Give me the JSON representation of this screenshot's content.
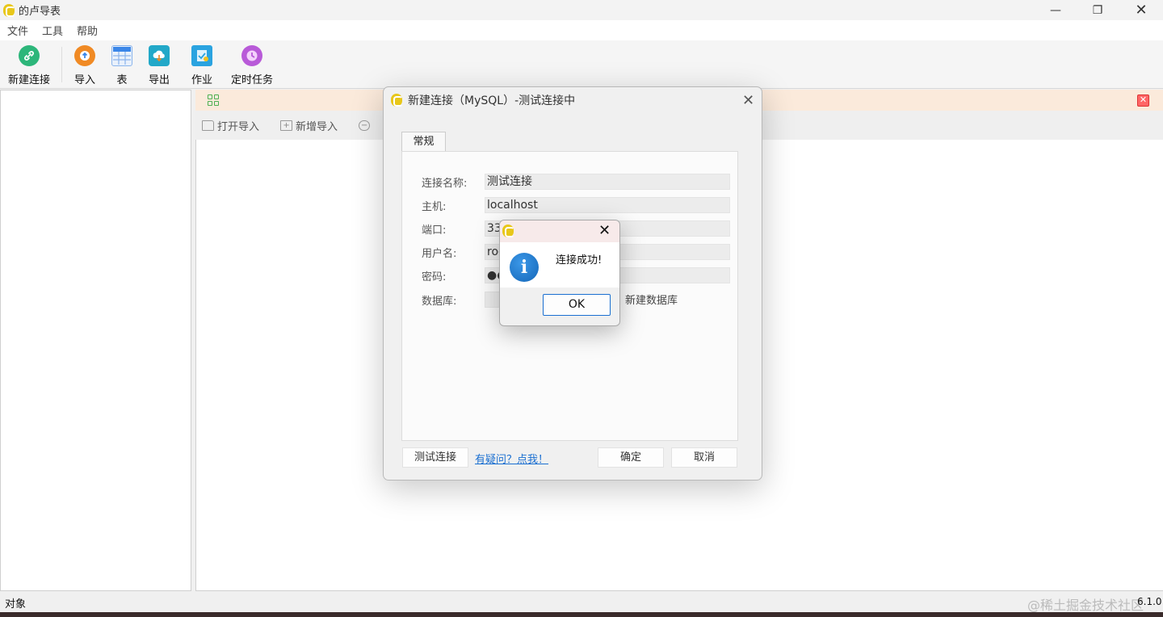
{
  "window": {
    "title": "的卢导表",
    "controls": {
      "minimize": "—",
      "maximize": "❐",
      "close": "✕"
    }
  },
  "menu": [
    "文件",
    "工具",
    "帮助"
  ],
  "toolbar": {
    "items": [
      {
        "label": "新建连接",
        "icon": "link-icon",
        "color": "#2db67a"
      },
      {
        "label": "导入",
        "icon": "import-icon",
        "color": "#f08a24"
      },
      {
        "label": "表",
        "icon": "table-icon",
        "color": "#3a86e8"
      },
      {
        "label": "导出",
        "icon": "export-icon",
        "color": "#22a8c8"
      },
      {
        "label": "作业",
        "icon": "job-icon",
        "color": "#2aa3e0"
      },
      {
        "label": "定时任务",
        "icon": "timer-icon",
        "color": "#b85ad8"
      }
    ]
  },
  "main": {
    "actions": [
      "打开导入",
      "新增导入"
    ]
  },
  "dialog": {
    "title": "新建连接（MySQL）-测试连接中",
    "tab": "常规",
    "fields": [
      {
        "label": "连接名称:",
        "value": "测试连接"
      },
      {
        "label": "主机:",
        "value": "localhost"
      },
      {
        "label": "端口:",
        "value": "330"
      },
      {
        "label": "用户名:",
        "value": "roo"
      },
      {
        "label": "密码:",
        "value": "●●"
      },
      {
        "label": "数据库:",
        "value": ""
      }
    ],
    "new_database": "新建数据库",
    "test_button": "测试连接",
    "help_link": "有疑问？点我！",
    "ok_button": "确定",
    "cancel_button": "取消"
  },
  "message": {
    "text": "连接成功!",
    "ok": "OK"
  },
  "status": {
    "left": "对象",
    "right": "6.1.0",
    "watermark": "@稀土掘金技术社区"
  }
}
